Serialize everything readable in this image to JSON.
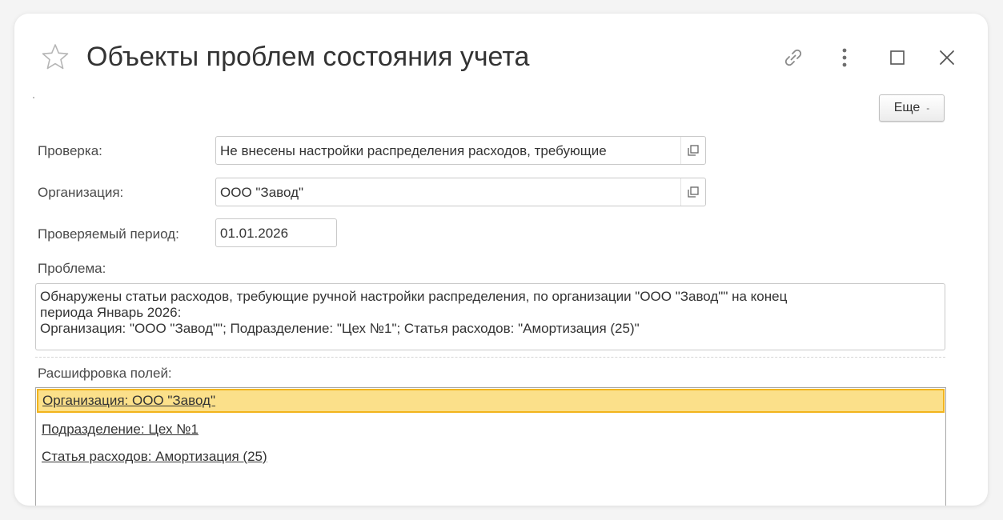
{
  "window": {
    "title": "Объекты проблем состояния учета"
  },
  "toolbar": {
    "more_label": "Еще",
    "more_caret": "-"
  },
  "form": {
    "check_label": "Проверка:",
    "check_value": "Не внесены настройки распределения расходов, требующие",
    "org_label": "Организация:",
    "org_value": "ООО \"Завод\"",
    "period_label": "Проверяемый период:",
    "period_value": "01.01.2026",
    "problem_label": "Проблема:",
    "problem_lines": [
      "Обнаружены статьи расходов, требующие ручной настройки распределения, по организации \"ООО \"Завод\"\" на конец",
      "периода Январь 2026:",
      "Организация: \"ООО \"Завод\"\"; Подразделение: \"Цех №1\"; Статья расходов: \"Амортизация (25)\""
    ],
    "fields_label": "Расшифровка полей:",
    "fields_items": [
      "Организация: ООО \"Завод\"",
      "Подразделение: Цех №1",
      "Статья расходов: Амортизация (25)"
    ]
  },
  "colors": {
    "selected_fill": "#fbe08a",
    "selected_border": "#f2b41c"
  },
  "icons": [
    "star-icon",
    "link-icon",
    "menu-dots-icon",
    "maximize-icon",
    "close-icon",
    "open-icon"
  ]
}
